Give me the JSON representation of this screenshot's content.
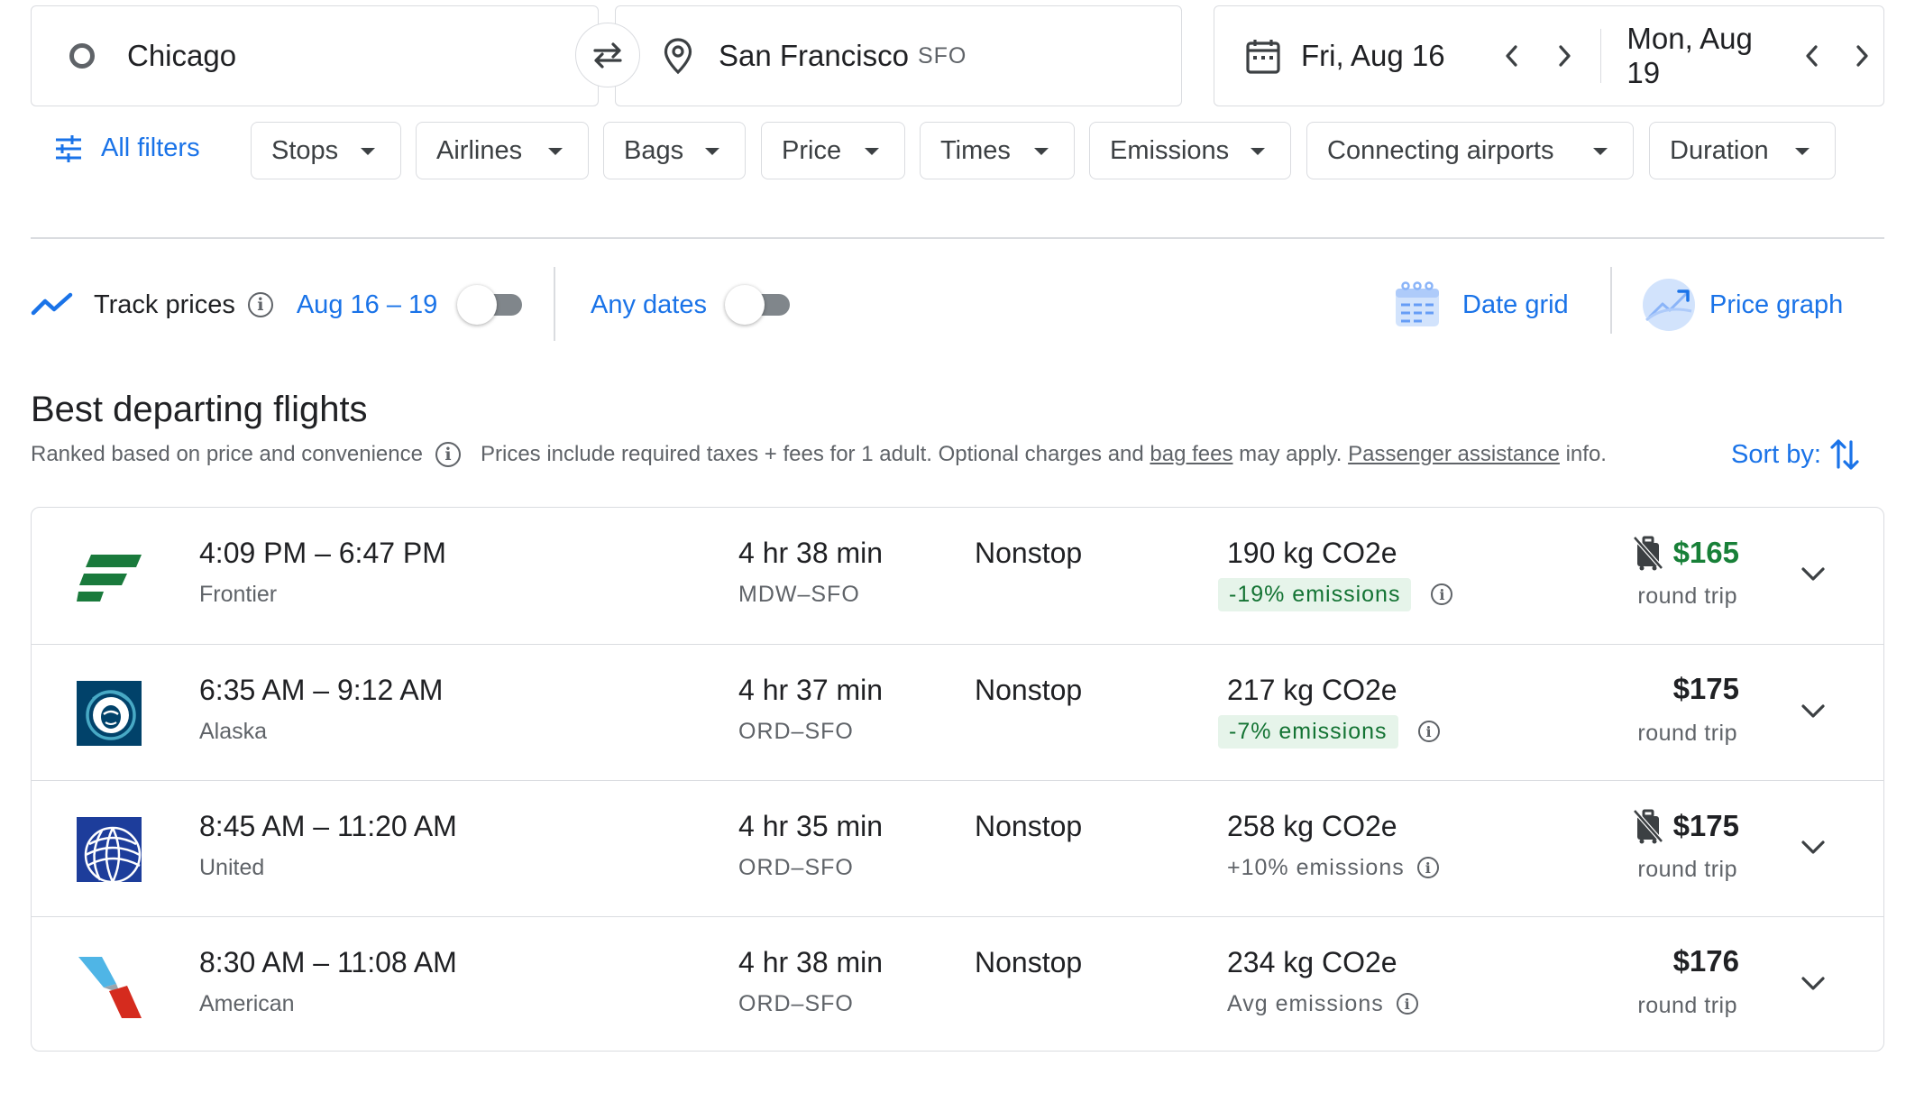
{
  "search": {
    "origin": "Chicago",
    "destination": "San Francisco",
    "destination_code": "SFO",
    "depart_date": "Fri, Aug 16",
    "return_date": "Mon, Aug 19"
  },
  "filters": {
    "all_filters_label": "All filters",
    "chips": [
      "Stops",
      "Airlines",
      "Bags",
      "Price",
      "Times",
      "Emissions",
      "Connecting airports",
      "Duration"
    ]
  },
  "track": {
    "label": "Track prices",
    "dates_label": "Aug 16 – 19",
    "any_dates_label": "Any dates",
    "date_grid_label": "Date grid",
    "price_graph_label": "Price graph"
  },
  "results": {
    "heading": "Best departing flights",
    "ranked_note": "Ranked based on price and convenience",
    "prices_note": "Prices include required taxes + fees for 1 adult. Optional charges and",
    "bag_fees_link": "bag fees",
    "may_apply": "may apply.",
    "passenger_link": "Passenger assistance",
    "info_word": "info.",
    "sort_label": "Sort by:"
  },
  "flights": [
    {
      "times": "4:09 PM – 6:47 PM",
      "airline": "Frontier",
      "duration": "4 hr 38 min",
      "route": "MDW–SFO",
      "stops": "Nonstop",
      "co2": "190 kg CO2e",
      "emissions": "-19% emissions",
      "price": "$165",
      "price_note": "round trip",
      "price_color": "#188038"
    },
    {
      "times": "6:35 AM – 9:12 AM",
      "airline": "Alaska",
      "duration": "4 hr 37 min",
      "route": "ORD–SFO",
      "stops": "Nonstop",
      "co2": "217 kg CO2e",
      "emissions": "-7% emissions",
      "price": "$175",
      "price_note": "round trip"
    },
    {
      "times": "8:45 AM – 11:20 AM",
      "airline": "United",
      "duration": "4 hr 35 min",
      "route": "ORD–SFO",
      "stops": "Nonstop",
      "co2": "258 kg CO2e",
      "emissions": "+10% emissions",
      "price": "$175",
      "price_note": "round trip"
    },
    {
      "times": "8:30 AM – 11:08 AM",
      "airline": "American",
      "duration": "4 hr 38 min",
      "route": "ORD–SFO",
      "stops": "Nonstop",
      "co2": "234 kg CO2e",
      "emissions": "Avg emissions",
      "price": "$176",
      "price_note": "round trip"
    }
  ]
}
